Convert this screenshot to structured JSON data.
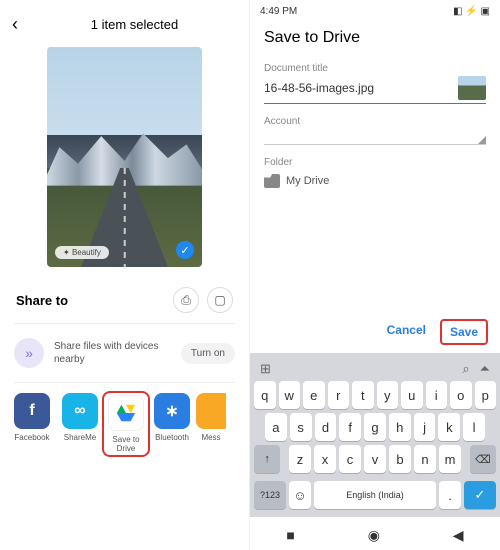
{
  "left": {
    "title": "1 item selected",
    "beautify_label": "Beautify",
    "share_heading": "Share to",
    "nearby_text": "Share files with devices nearby",
    "turn_on": "Turn on",
    "apps": [
      {
        "label": "Facebook"
      },
      {
        "label": "ShareMe"
      },
      {
        "label": "Save to Drive"
      },
      {
        "label": "Bluetooth"
      },
      {
        "label": "Mess"
      }
    ]
  },
  "right": {
    "time": "4:49 PM",
    "status_icons": "◧ ⚡ ▣",
    "title": "Save to Drive",
    "doc_label": "Document title",
    "doc_value": "16-48-56-images.jpg",
    "account_label": "Account",
    "folder_label": "Folder",
    "folder_value": "My Drive",
    "cancel": "Cancel",
    "save": "Save",
    "keyboard": {
      "row1": [
        "q",
        "w",
        "e",
        "r",
        "t",
        "y",
        "u",
        "i",
        "o",
        "p"
      ],
      "row2": [
        "a",
        "s",
        "d",
        "f",
        "g",
        "h",
        "j",
        "k",
        "l"
      ],
      "row3": [
        "z",
        "x",
        "c",
        "v",
        "b",
        "n",
        "m"
      ],
      "shift": "↑",
      "backspace": "⌫",
      "symbols": "?123",
      "emoji": "☺",
      "space": "English (India)",
      "period": ".",
      "enter": "✓"
    }
  }
}
